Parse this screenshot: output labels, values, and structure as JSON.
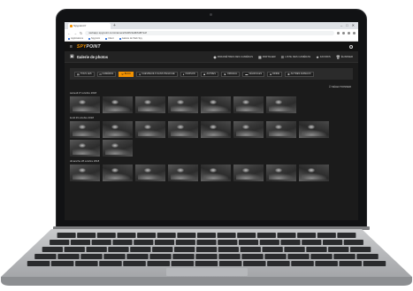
{
  "browser": {
    "tab_title": "Spypoint fr",
    "new_tab": "+",
    "url": "webapp.spypoint.com/camera/6d4fc3a9b6d87a1f",
    "bookmarks": [
      "Applications",
      "Spypoint",
      "Client",
      "Galerie de Web Spy"
    ]
  },
  "app": {
    "logo_main": "SPY",
    "logo_rest": "POINT",
    "page_title": "Galerie de photos",
    "header_actions": [
      {
        "icon": "camera-icon",
        "label": "PARAMÈTRES DES CAMÉRAS"
      },
      {
        "icon": "calendar-icon",
        "label": "PARTAGER"
      },
      {
        "icon": "list-icon",
        "label": "LISTE DES CAMÉRAS"
      },
      {
        "icon": "star-icon",
        "label": "FAVORIS"
      },
      {
        "icon": "trash-icon",
        "label": "ÉLIMINER"
      }
    ]
  },
  "filters": [
    {
      "icon": "filter-icon",
      "label": "TOUS LES",
      "active": false
    },
    {
      "icon": "camera-icon",
      "label": "CAMÉRAS",
      "active": false
    },
    {
      "icon": "deer-icon",
      "label": "BUCK",
      "active": true
    },
    {
      "icon": "deer-icon",
      "label": "CHEVREUILS SANS PANACHE",
      "active": false
    },
    {
      "icon": "bear-icon",
      "label": "OURSON",
      "active": false
    },
    {
      "icon": "person-icon",
      "label": "AUTRES",
      "active": false
    },
    {
      "icon": "moose-icon",
      "label": "ORIGNAL",
      "active": false
    },
    {
      "icon": "car-icon",
      "label": "VÉHICULES",
      "active": false
    },
    {
      "icon": "bird-icon",
      "label": "DINDE",
      "active": false
    },
    {
      "icon": "paw-icon",
      "label": "AUTRES ANIMAUX",
      "active": false
    }
  ],
  "select_label": "SÉLECTIONNER",
  "days": [
    {
      "label": "samedi 27 octobre 2018",
      "count": 7
    },
    {
      "label": "lundi 29 octobre 2018",
      "count": 10
    },
    {
      "label": "dimanche 28 octobre 2018",
      "count": 8
    }
  ]
}
